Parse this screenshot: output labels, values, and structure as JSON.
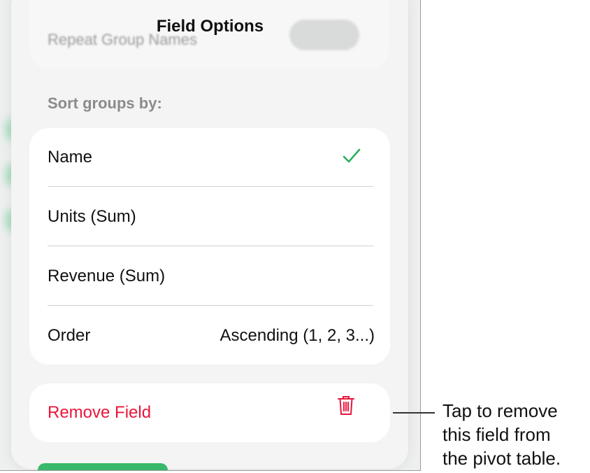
{
  "header": {
    "title": "Field Options",
    "blurred_row_label": "Repeat Group Names"
  },
  "sort": {
    "section_label": "Sort groups by:",
    "options": [
      {
        "label": "Name",
        "selected": true
      },
      {
        "label": "Units (Sum)",
        "selected": false
      },
      {
        "label": "Revenue (Sum)",
        "selected": false
      }
    ],
    "order_label": "Order",
    "order_value": "Ascending (1, 2, 3...)",
    "check_icon": "checkmark-icon"
  },
  "remove": {
    "label": "Remove Field",
    "icon": "trash-icon",
    "color": "#e8163c"
  },
  "callout": {
    "line1": "Tap to remove",
    "line2": "this field from",
    "line3": "the pivot table."
  },
  "colors": {
    "accent_green": "#25b15c",
    "destructive_red": "#e8163c"
  }
}
